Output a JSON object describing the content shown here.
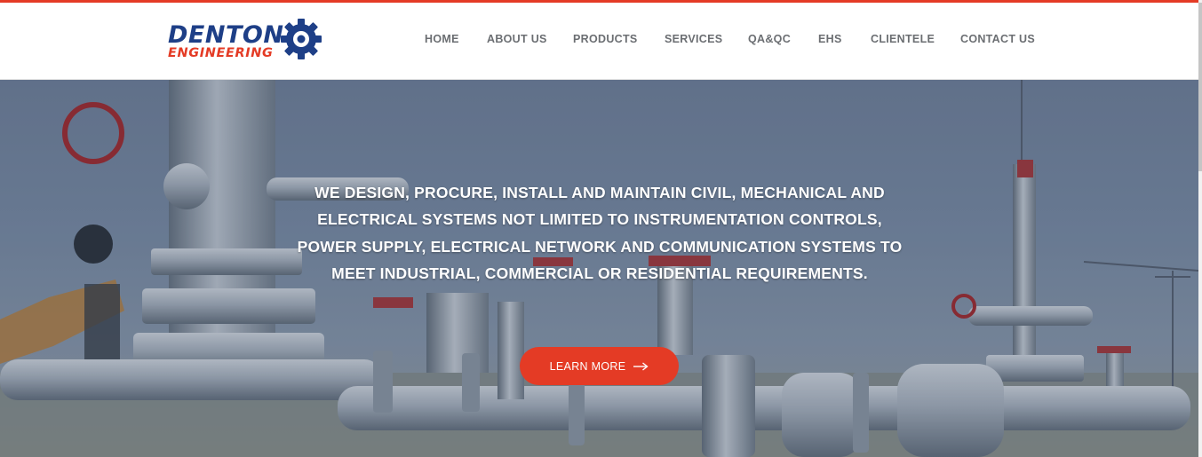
{
  "brand": {
    "line1": "DENTON",
    "line2": "ENGINEERING",
    "primary_color": "#1e3f87",
    "accent_color": "#e43b25",
    "logo_icon": "gear-icon"
  },
  "nav": {
    "items": [
      {
        "label": "HOME"
      },
      {
        "label": "ABOUT US"
      },
      {
        "label": "PRODUCTS"
      },
      {
        "label": "SERVICES"
      },
      {
        "label": "QA&QC"
      },
      {
        "label": "EHS"
      },
      {
        "label": "CLIENTELE"
      },
      {
        "label": "CONTACT US"
      }
    ]
  },
  "hero": {
    "lines": [
      "WE DESIGN, PROCURE, INSTALL AND MAINTAIN CIVIL, MECHANICAL AND",
      "ELECTRICAL SYSTEMS NOT LIMITED TO INSTRUMENTATION CONTROLS,",
      "POWER SUPPLY, ELECTRICAL NETWORK AND COMMUNICATION SYSTEMS TO",
      "MEET INDUSTRIAL, COMMERCIAL OR RESIDENTIAL REQUIREMENTS."
    ],
    "cta_label": "LEARN MORE",
    "cta_icon": "arrow-right-icon",
    "background": "industrial pipeline valves photo"
  }
}
